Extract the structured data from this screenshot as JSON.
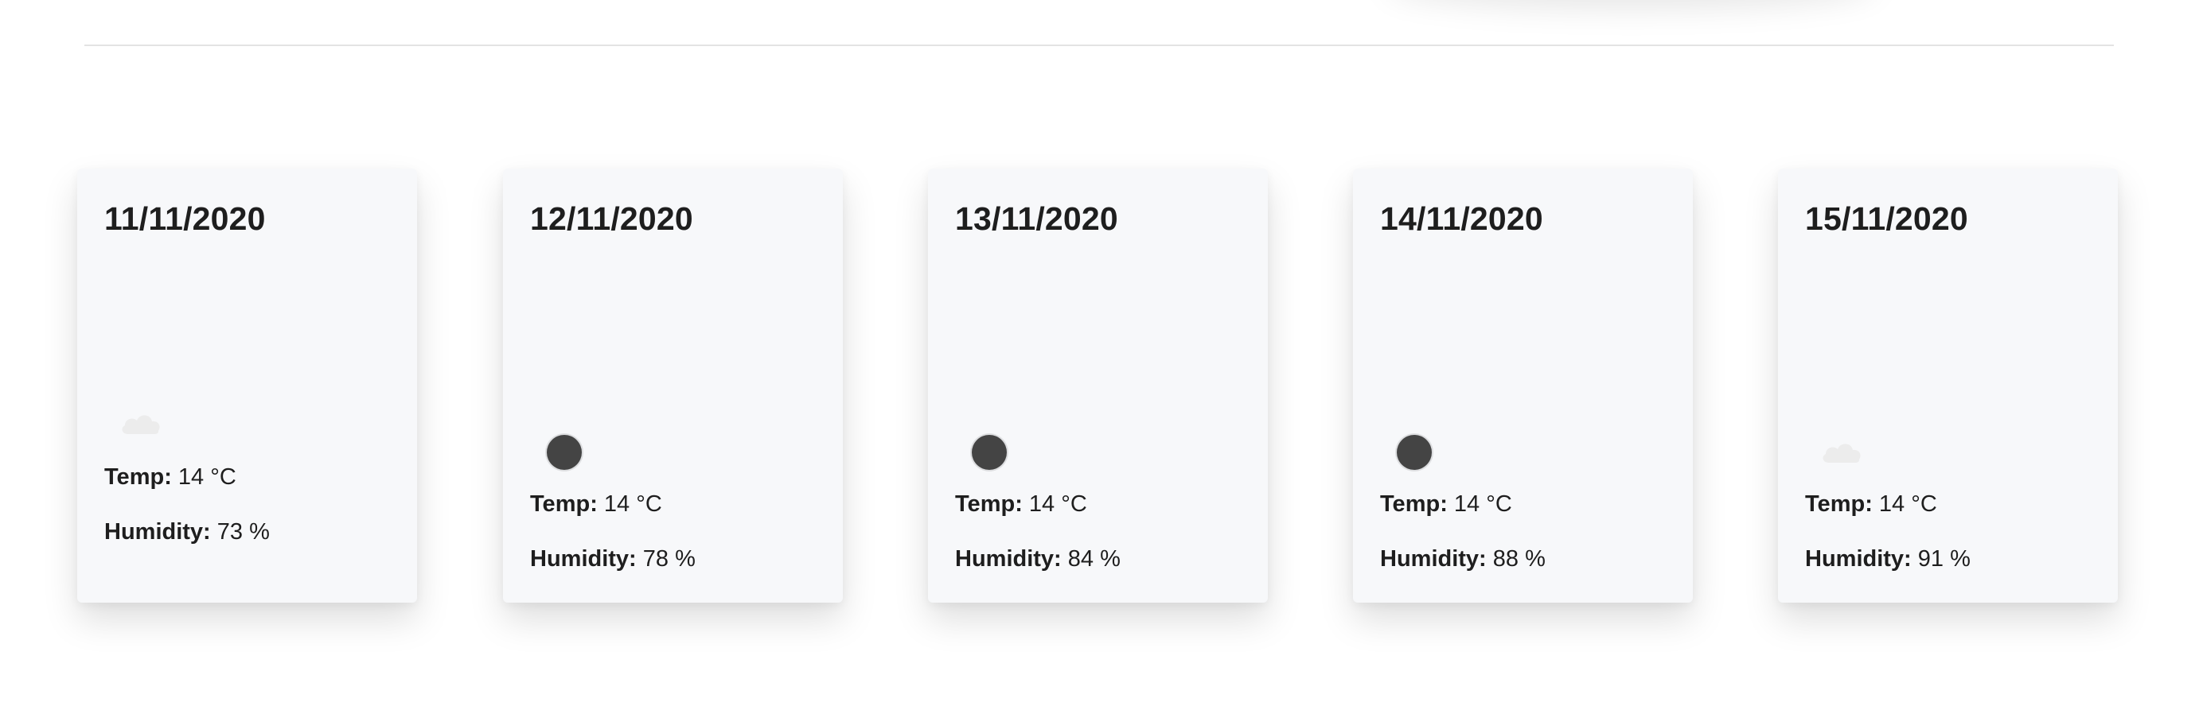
{
  "labels": {
    "temp": "Temp:",
    "humidity": "Humidity:"
  },
  "days": [
    {
      "date": "11/11/2020",
      "icon": "cloud-icon",
      "temp": "14 °C",
      "humidity": "73 %"
    },
    {
      "date": "12/11/2020",
      "icon": "dark-circle-icon",
      "temp": "14 °C",
      "humidity": "78 %"
    },
    {
      "date": "13/11/2020",
      "icon": "dark-circle-icon",
      "temp": "14 °C",
      "humidity": "84 %"
    },
    {
      "date": "14/11/2020",
      "icon": "dark-circle-icon",
      "temp": "14 °C",
      "humidity": "88 %"
    },
    {
      "date": "15/11/2020",
      "icon": "cloud-icon",
      "temp": "14 °C",
      "humidity": "91 %"
    }
  ],
  "colors": {
    "card_background": "#f7f8fa",
    "text": "#1e1e1e",
    "dark_icon": "#444444",
    "cloud_icon": "#ececec"
  }
}
